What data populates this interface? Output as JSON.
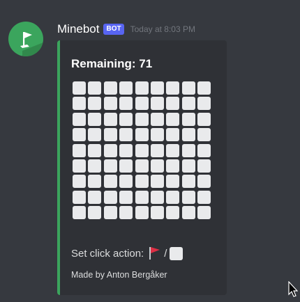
{
  "message": {
    "author": "Minebot",
    "bot_tag": "BOT",
    "timestamp": "Today at 8:03 PM",
    "avatar_icon": "green-flag-avatar-icon"
  },
  "embed": {
    "accent_color": "#3ba55d",
    "title": "Remaining: 71",
    "board": {
      "rows": 9,
      "columns": 9,
      "cell_state": "unrevealed"
    },
    "action_label": "Set click action:",
    "action_flag_icon": "red-flag-icon",
    "action_separator": "/",
    "action_square_icon": "white-square-icon",
    "footer": "Made by Anton Bergåker"
  },
  "colors": {
    "background": "#36393f",
    "embed_background": "#2f3136",
    "bot_tag": "#5865f2",
    "cell": "#e9eaec"
  }
}
